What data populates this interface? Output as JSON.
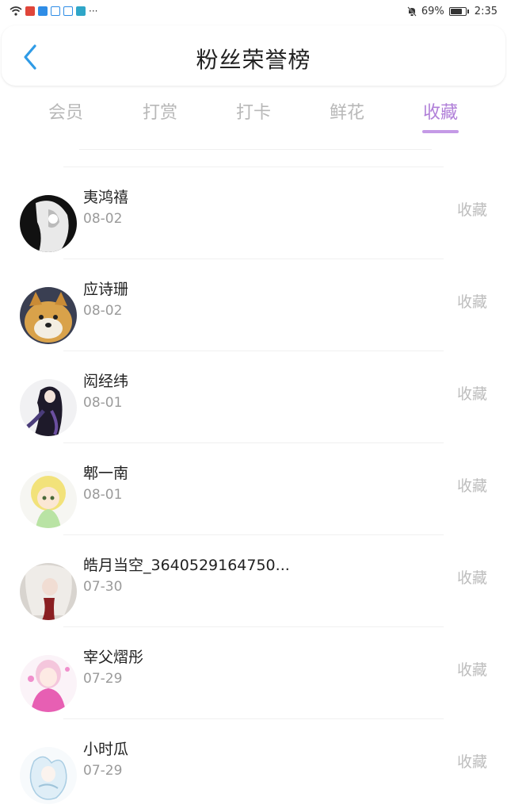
{
  "status_bar": {
    "battery": "69%",
    "time": "2:35"
  },
  "header": {
    "title": "粉丝荣誉榜"
  },
  "tabs": [
    {
      "label": "会员"
    },
    {
      "label": "打赏"
    },
    {
      "label": "打卡"
    },
    {
      "label": "鲜花"
    },
    {
      "label": "收藏"
    }
  ],
  "active_tab": "收藏",
  "colors": {
    "accent": "#b07fd8",
    "underline": "#c49ae6",
    "back_arrow": "#2f9be6"
  },
  "fans": [
    {
      "name": "夷鸿禧",
      "date": "08-02",
      "action": "收藏"
    },
    {
      "name": "应诗珊",
      "date": "08-02",
      "action": "收藏"
    },
    {
      "name": "闳经纬",
      "date": "08-01",
      "action": "收藏"
    },
    {
      "name": "郫一南",
      "date": "08-01",
      "action": "收藏"
    },
    {
      "name": "皓月当空_3640529164750...",
      "date": "07-30",
      "action": "收藏"
    },
    {
      "name": "宰父熠彤",
      "date": "07-29",
      "action": "收藏"
    },
    {
      "name": "小时瓜",
      "date": "07-29",
      "action": "收藏"
    }
  ]
}
